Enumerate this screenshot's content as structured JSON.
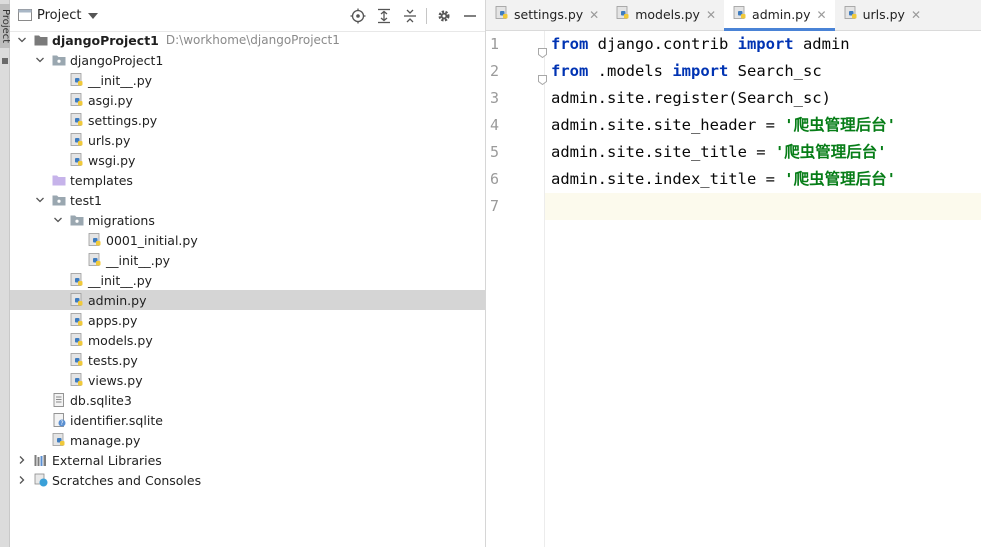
{
  "stripe": {
    "label": "Project"
  },
  "panel": {
    "title": "Project"
  },
  "tree": [
    {
      "label": "djangoProject1",
      "path": "D:\\workhome\\djangoProject1",
      "indent": 0,
      "chev": "open",
      "icon": "folder-dark",
      "bold": true
    },
    {
      "label": "djangoProject1",
      "indent": 1,
      "chev": "open",
      "icon": "folder-pkg"
    },
    {
      "label": "__init__.py",
      "indent": 2,
      "chev": "none",
      "icon": "py"
    },
    {
      "label": "asgi.py",
      "indent": 2,
      "chev": "none",
      "icon": "py"
    },
    {
      "label": "settings.py",
      "indent": 2,
      "chev": "none",
      "icon": "py"
    },
    {
      "label": "urls.py",
      "indent": 2,
      "chev": "none",
      "icon": "py"
    },
    {
      "label": "wsgi.py",
      "indent": 2,
      "chev": "none",
      "icon": "py"
    },
    {
      "label": "templates",
      "indent": 1,
      "chev": "none",
      "icon": "folder-purple"
    },
    {
      "label": "test1",
      "indent": 1,
      "chev": "open",
      "icon": "folder-pkg"
    },
    {
      "label": "migrations",
      "indent": 2,
      "chev": "open",
      "icon": "folder-pkg"
    },
    {
      "label": "0001_initial.py",
      "indent": 3,
      "chev": "none",
      "icon": "py"
    },
    {
      "label": "__init__.py",
      "indent": 3,
      "chev": "none",
      "icon": "py"
    },
    {
      "label": "__init__.py",
      "indent": 2,
      "chev": "none",
      "icon": "py"
    },
    {
      "label": "admin.py",
      "indent": 2,
      "chev": "none",
      "icon": "py",
      "selected": true
    },
    {
      "label": "apps.py",
      "indent": 2,
      "chev": "none",
      "icon": "py"
    },
    {
      "label": "models.py",
      "indent": 2,
      "chev": "none",
      "icon": "py"
    },
    {
      "label": "tests.py",
      "indent": 2,
      "chev": "none",
      "icon": "py"
    },
    {
      "label": "views.py",
      "indent": 2,
      "chev": "none",
      "icon": "py"
    },
    {
      "label": "db.sqlite3",
      "indent": 1,
      "chev": "none",
      "icon": "file"
    },
    {
      "label": "identifier.sqlite",
      "indent": 1,
      "chev": "none",
      "icon": "file-q"
    },
    {
      "label": "manage.py",
      "indent": 1,
      "chev": "none",
      "icon": "py"
    },
    {
      "label": "External Libraries",
      "indent": 0,
      "chev": "closed",
      "icon": "libs"
    },
    {
      "label": "Scratches and Consoles",
      "indent": 0,
      "chev": "closed",
      "icon": "scratch"
    }
  ],
  "tabs": [
    {
      "label": "settings.py",
      "active": false
    },
    {
      "label": "models.py",
      "active": false
    },
    {
      "label": "admin.py",
      "active": true
    },
    {
      "label": "urls.py",
      "active": false
    }
  ],
  "editor": {
    "lines": [
      {
        "n": "1",
        "tokens": [
          [
            "kw",
            "from"
          ],
          [
            "t",
            " django.contrib "
          ],
          [
            "kw",
            "import"
          ],
          [
            "t",
            " admin"
          ]
        ],
        "fold": true
      },
      {
        "n": "2",
        "tokens": [
          [
            "kw",
            "from"
          ],
          [
            "t",
            " .models "
          ],
          [
            "kw",
            "import"
          ],
          [
            "t",
            " Search_sc"
          ]
        ],
        "fold": true
      },
      {
        "n": "3",
        "tokens": [
          [
            "t",
            "admin.site.register(Search_sc)"
          ]
        ]
      },
      {
        "n": "4",
        "tokens": [
          [
            "t",
            "admin.site.site_header = "
          ],
          [
            "str",
            "'爬虫管理后台'"
          ]
        ]
      },
      {
        "n": "5",
        "tokens": [
          [
            "t",
            "admin.site.site_title = "
          ],
          [
            "str",
            "'爬虫管理后台'"
          ]
        ]
      },
      {
        "n": "6",
        "tokens": [
          [
            "t",
            "admin.site.index_title = "
          ],
          [
            "str",
            "'爬虫管理后台'"
          ]
        ]
      },
      {
        "n": "7",
        "tokens": [],
        "current": true
      }
    ]
  },
  "colors": {
    "keyword": "#0033b3",
    "string": "#067d17",
    "selection": "#d5d5d5",
    "current_line": "#fcfaed",
    "tab_accent": "#4a83d6"
  }
}
